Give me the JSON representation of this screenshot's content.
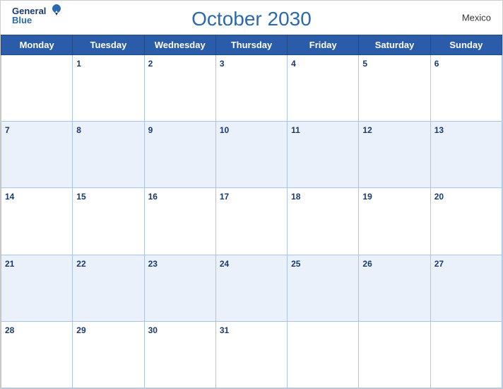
{
  "header": {
    "title": "October 2030",
    "country": "Mexico",
    "logo": {
      "line1": "General",
      "line2": "Blue"
    }
  },
  "weekdays": [
    "Monday",
    "Tuesday",
    "Wednesday",
    "Thursday",
    "Friday",
    "Saturday",
    "Sunday"
  ],
  "weeks": [
    [
      null,
      1,
      2,
      3,
      4,
      5,
      6
    ],
    [
      7,
      8,
      9,
      10,
      11,
      12,
      13
    ],
    [
      14,
      15,
      16,
      17,
      18,
      19,
      20
    ],
    [
      21,
      22,
      23,
      24,
      25,
      26,
      27
    ],
    [
      28,
      29,
      30,
      31,
      null,
      null,
      null
    ]
  ]
}
